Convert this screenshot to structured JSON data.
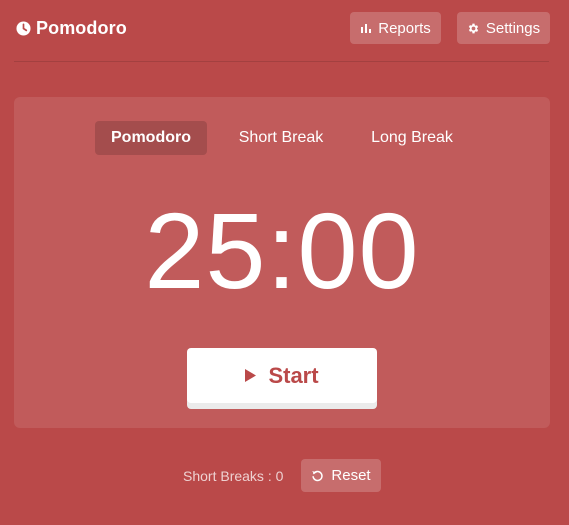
{
  "app": {
    "title": "Pomodoro"
  },
  "header": {
    "reports_label": "Reports",
    "settings_label": "Settings"
  },
  "tabs": [
    {
      "label": "Pomodoro",
      "active": true
    },
    {
      "label": "Short Break",
      "active": false
    },
    {
      "label": "Long Break",
      "active": false
    }
  ],
  "timer": {
    "display": "25:00"
  },
  "controls": {
    "start_label": "Start",
    "reset_label": "Reset"
  },
  "stats": {
    "short_breaks_text": "Short Breaks : 0"
  },
  "colors": {
    "background": "#ba4949",
    "accent_text": "#ba4949",
    "foreground": "#ffffff"
  },
  "icons": {
    "brand": "clock-icon",
    "reports": "bar-chart-icon",
    "settings": "gear-icon",
    "start": "play-icon",
    "reset": "reset-icon"
  }
}
